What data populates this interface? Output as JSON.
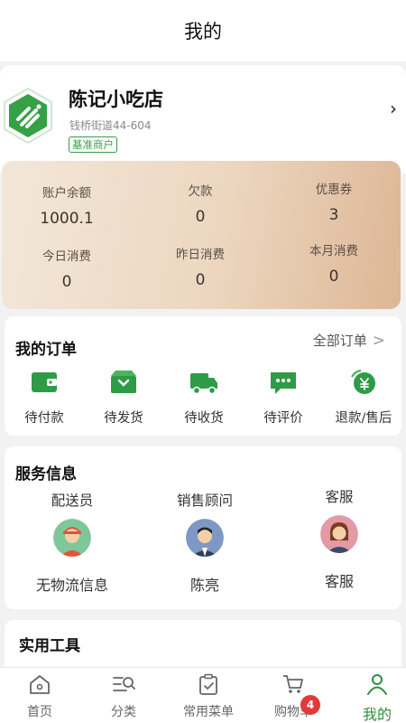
{
  "header": {
    "title": "我的"
  },
  "profile": {
    "shop_name": "陈记小吃店",
    "address": "钱桥街道44-604",
    "tag": "基准商户",
    "arrow": "›"
  },
  "account": {
    "items": [
      {
        "label": "账户余额",
        "value": "1000.1"
      },
      {
        "label": "欠款",
        "value": "0"
      },
      {
        "label": "优惠券",
        "value": "3"
      },
      {
        "label": "今日消费",
        "value": "0"
      },
      {
        "label": "昨日消费",
        "value": "0"
      },
      {
        "label": "本月消费",
        "value": "0"
      }
    ]
  },
  "orders": {
    "title": "我的订单",
    "all_label": "全部订单",
    "items": [
      {
        "label": "待付款",
        "icon": "wallet-icon"
      },
      {
        "label": "待发货",
        "icon": "box-icon"
      },
      {
        "label": "待收货",
        "icon": "truck-icon"
      },
      {
        "label": "待评价",
        "icon": "comment-icon"
      },
      {
        "label": "退款/售后",
        "icon": "refund-icon"
      }
    ]
  },
  "service": {
    "title": "服务信息",
    "items": [
      {
        "role": "配送员",
        "name": "无物流信息"
      },
      {
        "role": "销售顾问",
        "name": "陈亮"
      },
      {
        "role": "客服",
        "name": "客服"
      }
    ]
  },
  "tools": {
    "title": "实用工具"
  },
  "tabbar": {
    "items": [
      {
        "label": "首页",
        "icon": "home-icon"
      },
      {
        "label": "分类",
        "icon": "category-icon"
      },
      {
        "label": "常用菜单",
        "icon": "clipboard-icon"
      },
      {
        "label": "购物车",
        "icon": "cart-icon"
      },
      {
        "label": "我的",
        "icon": "user-icon"
      }
    ],
    "cart_badge": "4",
    "active": "我的"
  },
  "colors": {
    "brand_green": "#2f8f3c",
    "badge_red": "#e23a3a"
  }
}
